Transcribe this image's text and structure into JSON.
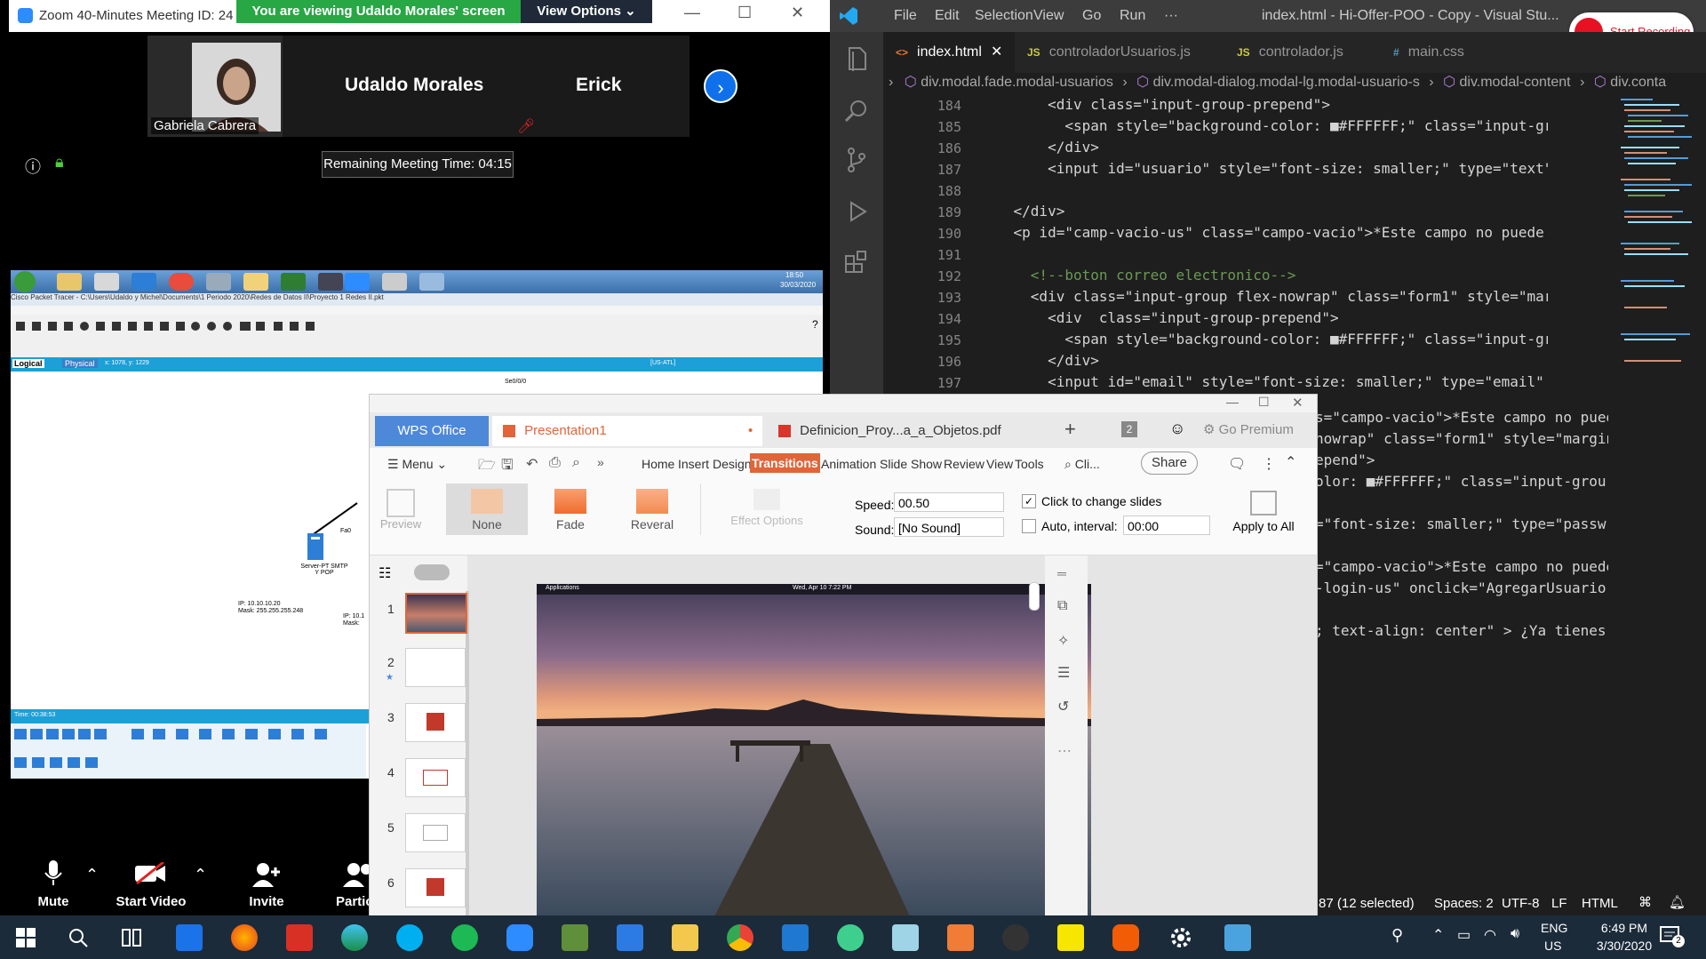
{
  "zoom": {
    "window_title": "Zoom 40-Minutes Meeting ID: 24",
    "banner_text": "You are viewing Udaldo Morales' screen",
    "view_options_label": "View Options",
    "participants": [
      {
        "name": "Gabriela Cabrera",
        "has_video": true
      },
      {
        "name": "Udaldo Morales",
        "has_video": false
      },
      {
        "name": "Erick",
        "has_video": false,
        "muted": true
      }
    ],
    "remaining_time_label": "Remaining Meeting Time: 04:15",
    "bottom_bar": {
      "mute_label": "Mute",
      "start_video_label": "Start Video",
      "invite_label": "Invite",
      "participants_label": "Particip"
    },
    "colors": {
      "banner": "#28a745",
      "accent": "#0e71eb"
    }
  },
  "shared_screen": {
    "app_title": "Cisco Packet Tracer - C:\\Users\\Udaldo y Michel\\Documents\\1 Periodo 2020\\Redes de Datos II\\Proyecto 1 Redes II.pkt",
    "logical_tab": "Logical",
    "physical_tab": "Physical",
    "coords_text": "x: 1078, y: 1229",
    "region_text": "[US-ATL]",
    "link_label": "Se0/0/0",
    "port_label": "Fa0",
    "server_label": "Server-PT SMTP Y POP",
    "ip_text": "IP: 10.10.10.20",
    "mask_text": "Mask: 255.255.255.248",
    "ip_text_2": "IP: 10.1",
    "mask_text_2": "Mask:",
    "time_text": "Time: 00:38:53",
    "clock_time": "18:50",
    "clock_date": "30/03/2020"
  },
  "vscode": {
    "menu": [
      "File",
      "Edit",
      "Selection",
      "View",
      "Go",
      "Run",
      "···"
    ],
    "window_title": "index.html - Hi-Offer-POO - Copy - Visual Stu...",
    "recording_label": "Start Recording",
    "tabs": [
      {
        "label": "index.html",
        "icon": "<>",
        "active": true
      },
      {
        "label": "controladorUsuarios.js",
        "icon": "JS",
        "active": false
      },
      {
        "label": "controlador.js",
        "icon": "JS",
        "active": false
      },
      {
        "label": "main.css",
        "icon": "#",
        "active": false
      }
    ],
    "breadcrumb": [
      "div.modal.fade.modal-usuarios",
      "div.modal-dialog.modal-lg.modal-usuario-s",
      "div.modal-content",
      "div.conta"
    ],
    "line_numbers": [
      "184",
      "185",
      "186",
      "187",
      "188",
      "189",
      "190",
      "191",
      "192",
      "193",
      "194",
      "195",
      "196",
      "197"
    ],
    "code_lines": [
      "        <div class=\"input-group-prepend\">",
      "          <span style=\"background-color: ■#FFFFFF;\" class=\"input-grou",
      "        </div>",
      "        <input id=\"usuario\" style=\"font-size: smaller;\" type=\"text\" cl",
      "",
      "    </div>",
      "    <p id=\"camp-vacio-us\" class=\"campo-vacio\">*Este campo no puede est",
      "",
      "      <!--boton correo electronico-->",
      "      <div class=\"input-group flex-nowrap\" class=\"form1\" style=\"margir",
      "        <div  class=\"input-group-prepend\">",
      "          <span style=\"background-color: ■#FFFFFF;\" class=\"input-grou",
      "        </div>",
      "        <input id=\"email\" style=\"font-size: smaller;\" type=\"email\" cla"
    ],
    "partial_lines": [
      "s=\"campo-vacio\">*Este campo no pued",
      "nowrap\" class=\"form1\" style=\"margin",
      "epend\">",
      "olor: ■#FFFFFF;\" class=\"input-grou",
      "",
      "=\"font-size: smaller;\" type=\"passw",
      "",
      "=\"campo-vacio\">*Este campo no puede",
      "-login-us\" onclick=\"AgregarUsuario(",
      "",
      "; text-align: center\" > ¿Ya tienes"
    ],
    "status": {
      "selection": "87 (12 selected)",
      "spaces": "Spaces: 2",
      "encoding": "UTF-8",
      "eol": "LF",
      "language": "HTML"
    }
  },
  "wps": {
    "tabs": [
      {
        "label": "WPS Office"
      },
      {
        "label": "Presentation1"
      },
      {
        "label": "Definicion_Proy...a_a_Objetos.pdf"
      }
    ],
    "tab_count_badge": "2",
    "go_premium_label": "Go Premium",
    "menu_label": "Menu",
    "ribbon_tabs": [
      "Home",
      "Insert",
      "Design",
      "Transitions",
      "Animation",
      "Slide Show",
      "Review",
      "View",
      "Tools"
    ],
    "search_label": "Cli...",
    "share_label": "Share",
    "preview_label": "Preview",
    "transitions": [
      "None",
      "Fade",
      "Reveral"
    ],
    "effect_options_label": "Effect Options",
    "speed_label": "Speed:",
    "speed_value": "00.50",
    "sound_label": "Sound:",
    "sound_value": "[No Sound]",
    "click_to_change_label": "Click to change slides",
    "click_to_change_checked": true,
    "auto_interval_label": "Auto, interval:",
    "auto_interval_value": "00:00",
    "apply_to_all_label": "Apply to All",
    "slide_numbers": [
      "1",
      "2",
      "3",
      "4",
      "5",
      "6"
    ],
    "slide_screen_menu": "Applications",
    "slide_screen_clock": "Wed, Apr 10   7:22 PM",
    "accent": "#e0653a"
  },
  "taskbar": {
    "language": "ENG",
    "region": "US",
    "time": "6:49 PM",
    "date": "3/30/2020",
    "notification_count": "2"
  }
}
